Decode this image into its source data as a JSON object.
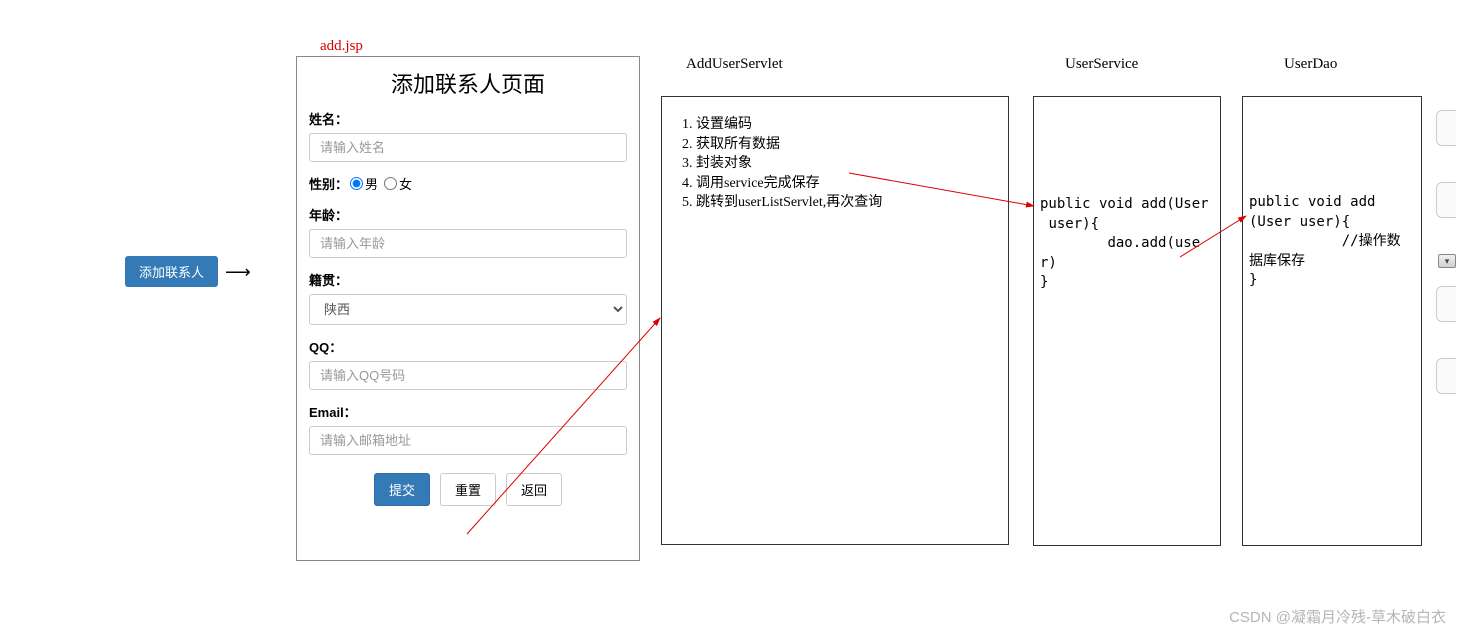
{
  "add_contact_button": "添加联系人",
  "jsp_filename": "add.jsp",
  "form": {
    "title": "添加联系人页面",
    "name_label": "姓名：",
    "name_placeholder": "请输入姓名",
    "gender_label": "性别：",
    "gender_male": "男",
    "gender_female": "女",
    "age_label": "年龄：",
    "age_placeholder": "请输入年龄",
    "origin_label": "籍贯：",
    "origin_value": "陕西",
    "qq_label": "QQ：",
    "qq_placeholder": "请输入QQ号码",
    "email_label": "Email：",
    "email_placeholder": "请输入邮箱地址",
    "submit": "提交",
    "reset": "重置",
    "back": "返回"
  },
  "servlet": {
    "header": "AddUserServlet",
    "steps": [
      "设置编码",
      "获取所有数据",
      "封装对象",
      "调用service完成保存"
    ],
    "step5": "跳转到userListServlet,再次查询"
  },
  "service": {
    "header": "UserService",
    "code": "public void add(User\n user){\n        dao.add(user)\n}"
  },
  "dao": {
    "header": "UserDao",
    "code": "public void add\n(User user){\n           //操作数\n据库保存\n}"
  },
  "watermark": "CSDN @凝霜月冷残-草木破白衣"
}
